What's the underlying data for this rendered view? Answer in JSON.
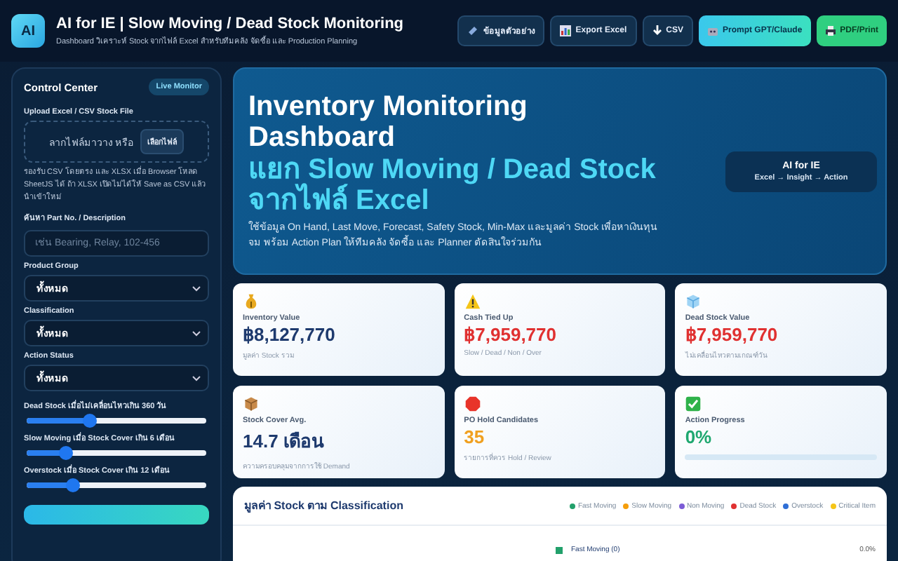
{
  "header": {
    "logo": "AI",
    "title": "AI for IE | Slow Moving / Dead Stock Monitoring",
    "subtitle": "Dashboard วิเคราะห์ Stock จากไฟล์ Excel สำหรับทีมคลัง จัดซื้อ และ Production Planning",
    "buttons": [
      {
        "label": "ข้อมูลตัวอย่าง",
        "kind": "sample"
      },
      {
        "label": "Export Excel",
        "kind": "excel"
      },
      {
        "label": "CSV",
        "kind": "csv"
      },
      {
        "label": "Prompt GPT/Claude",
        "kind": "prompt"
      },
      {
        "label": "PDF/Print",
        "kind": "print"
      }
    ]
  },
  "sidebar": {
    "title": "Control Center",
    "badge": "Live Monitor",
    "upload_label": "Upload Excel / CSV Stock File",
    "drop_text": "ลากไฟล์มาวาง หรือ",
    "choose_button": "เลือกไฟล์",
    "help": "รองรับ CSV โดยตรง และ XLSX เมื่อ Browser โหลด SheetJS ได้ ถ้า XLSX เปิดไม่ได้ให้ Save as CSV แล้วนำเข้าใหม่",
    "search_label": "ค้นหา Part No. / Description",
    "search_placeholder": "เช่น Bearing, Relay, 102-456",
    "selects": [
      {
        "label": "Product Group",
        "value": "ทั้งหมด"
      },
      {
        "label": "Classification",
        "value": "ทั้งหมด"
      },
      {
        "label": "Action Status",
        "value": "ทั้งหมด"
      }
    ],
    "sliders": [
      {
        "label": "Dead Stock เมื่อไม่เคลื่อนไหวเกิน 360 วัน",
        "level": 0.35
      },
      {
        "label": "Slow Moving เมื่อ Stock Cover เกิน 6 เดือน",
        "level": 0.22
      },
      {
        "label": "Overstock เมื่อ Stock Cover เกิน 12 เดือน",
        "level": 0.26
      }
    ]
  },
  "hero": {
    "title": "Inventory Monitoring Dashboard",
    "highlight": "แยก Slow Moving / Dead Stock จากไฟล์ Excel",
    "description": "ใช้ข้อมูล On Hand, Last Move, Forecast, Safety Stock, Min-Max และมูลค่า Stock เพื่อหาเงินทุนจม พร้อม Action Plan ให้ทีมคลัง จัดซื้อ และ Planner ตัดสินใจร่วมกัน",
    "badge_title": "AI for IE",
    "badge_subtitle": "Excel → Insight → Action"
  },
  "kpis": [
    {
      "kind": "money",
      "label": "Inventory Value",
      "value": "฿8,127,770",
      "note": "มูลค่า Stock รวม",
      "color": "#1e3a6e"
    },
    {
      "kind": "warning",
      "label": "Cash Tied Up",
      "value": "฿7,959,770",
      "note": "Slow / Dead / Non / Over",
      "color": "#e03131"
    },
    {
      "kind": "ice",
      "label": "Dead Stock Value",
      "value": "฿7,959,770",
      "note": "ไม่เคลื่อนไหวตามเกณฑ์วัน",
      "color": "#e03131"
    },
    {
      "kind": "box",
      "label": "Stock Cover Avg.",
      "value": "14.7 เดือน",
      "note": "ความครอบคลุมจากการใช้ Demand",
      "color": "#1e3a6e"
    },
    {
      "kind": "stop",
      "label": "PO Hold Candidates",
      "value": "35",
      "note": "รายการที่ควร Hold / Review",
      "color": "#f0a020"
    },
    {
      "kind": "check",
      "label": "Action Progress",
      "value": "0%",
      "color": "#1fa870",
      "level": 0
    }
  ],
  "chart_card": {
    "title": "มูลค่า Stock ตาม Classification",
    "legend": [
      {
        "label": "Fast Moving",
        "color": "#22a06b"
      },
      {
        "label": "Slow Moving",
        "color": "#f59e0b"
      },
      {
        "label": "Non Moving",
        "color": "#7c5cd6"
      },
      {
        "label": "Dead Stock",
        "color": "#e03131"
      },
      {
        "label": "Overstock",
        "color": "#2f6fd6"
      },
      {
        "label": "Critical Item",
        "color": "#f5c518"
      }
    ],
    "rows": [
      {
        "label": "Fast Moving (0)",
        "value": "0.0%",
        "color": "#22a06b"
      }
    ]
  }
}
